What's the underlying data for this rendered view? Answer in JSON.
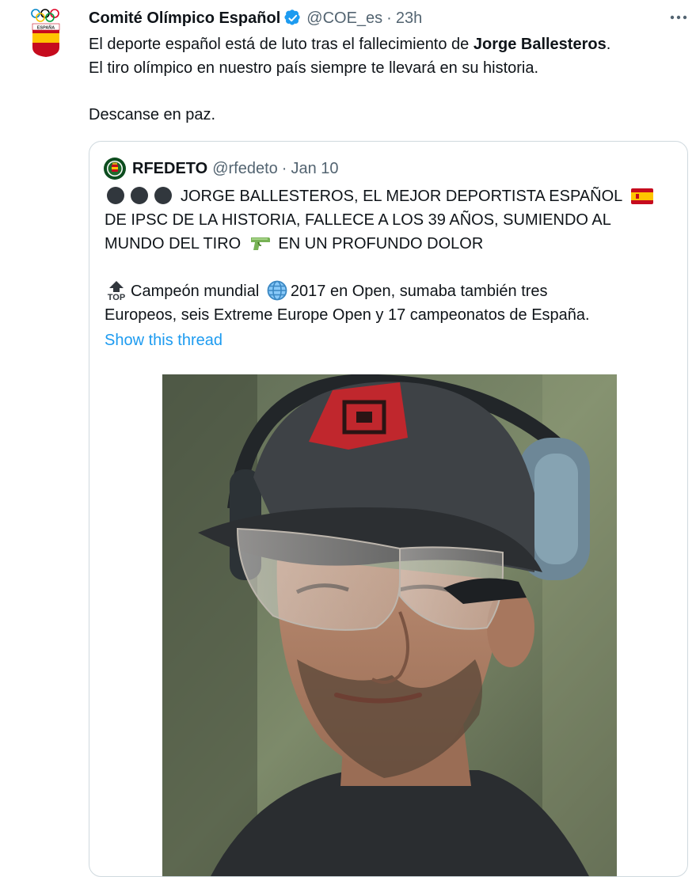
{
  "tweet": {
    "author_name": "Comité Olímpico Español",
    "handle": "@COE_es",
    "separator": "·",
    "time": "23h",
    "text_line1_before": "El deporte español está de luto tras el fallecimiento de ",
    "text_line1_bold": "Jorge Ballesteros",
    "text_line1_after": ".",
    "text_line2": "El tiro olímpico en nuestro país siempre te llevará en su historia.",
    "text_line3": "Descanse en paz.",
    "avatar_label": "ESPAÑA",
    "icons": {
      "verified": "verified-badge-icon",
      "more": "more-options-icon"
    }
  },
  "quoted": {
    "author_name": "RFEDETO",
    "handle": "@rfedeto",
    "separator": "·",
    "date": "Jan 10",
    "line1": "JORGE BALLESTEROS, EL MEJOR DEPORTISTA ESPAÑOL",
    "line2": "DE IPSC DE LA HISTORIA, FALLECE A LOS 39 AÑOS, SUMIENDO AL",
    "line3_before": "MUNDO DEL TIRO",
    "line3_after": "EN UN PROFUNDO DOLOR",
    "para2_part1": "Campeón mundial",
    "para2_part2": "2017 en Open, sumaba también tres",
    "para2_line2": "Europeos, seis Extreme Europe Open y 17 campeonatos de España.",
    "show_thread": "Show this thread",
    "top_emoji_label": "TOP",
    "icons": {
      "circles": "black-circle-icon",
      "flag": "spain-flag-icon",
      "pistol": "water-pistol-icon",
      "globe": "globe-icon",
      "top": "top-arrow-icon"
    }
  },
  "colors": {
    "link": "#1d9bf0",
    "secondary": "#536471",
    "border": "#cfd9de",
    "text": "#0f1419"
  }
}
